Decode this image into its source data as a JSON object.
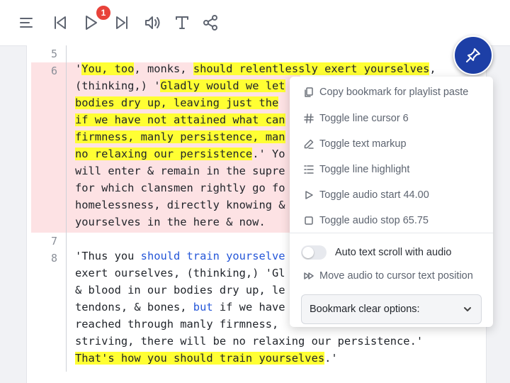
{
  "toolbar": {
    "icons": [
      "menu-icon",
      "skip-previous-icon",
      "play-icon",
      "skip-next-icon",
      "volume-icon",
      "text-icon",
      "share-icon"
    ],
    "badge_count": "1"
  },
  "editor": {
    "line_numbers": {
      "l5": "5",
      "l6": "6",
      "l7": "7",
      "l8": "8"
    },
    "highlight_color": "#fde2e4",
    "markup_color": "#ffff33",
    "link_color": "#2456d8"
  },
  "text": {
    "l6": {
      "r1a": "'",
      "r1b": "You, too",
      "r1c": ", monks, ",
      "r1d": "should relentlessly exert yourselves",
      "r1e": ",",
      "r2a": "(thinking,) '",
      "r2b": "Gladly would we let",
      "r3a": "bodies dry up, leaving just the",
      "r4a": "if we have not attained what can",
      "r5a": "firmness, manly persistence, man",
      "r6a": "no relaxing our persistence",
      "r6b": ".' Yo",
      "r7a": "will enter & remain in the supre",
      "r8a": "for which clansmen rightly go fo",
      "r9a": "homelessness, directly knowing &",
      "r10a": "yourselves in the here & now."
    },
    "l8": {
      "r1a": "'Thus you ",
      "r1b": "should train yourselve",
      "r2a": "exert ourselves, (thinking,) 'Gl",
      "r3a": "& blood in our bodies dry up, le",
      "r4a": "tendons, & bones, ",
      "r4b": "but",
      "r4c": " if we have",
      "r5a": "reached through manly firmness, ",
      "r6a": "striving, there will be no relaxing our persistence.'",
      "r7a": "That's how you should train yourselves",
      "r7b": ".'"
    }
  },
  "menu": {
    "items": [
      {
        "label": "Copy bookmark for playlist paste",
        "icon": "copy-icon"
      },
      {
        "label": "Toggle line cursor 6",
        "icon": "hash-icon"
      },
      {
        "label": "Toggle text markup",
        "icon": "pen-icon"
      },
      {
        "label": "Toggle line highlight",
        "icon": "list-icon"
      },
      {
        "label": "Toggle audio start 44.00",
        "icon": "play-outline-icon"
      },
      {
        "label": "Toggle audio stop 65.75",
        "icon": "stop-icon"
      }
    ],
    "auto_scroll_label": "Auto text scroll with audio",
    "move_audio_label": "Move audio to cursor text position",
    "clear_select": "Bookmark clear options:"
  }
}
